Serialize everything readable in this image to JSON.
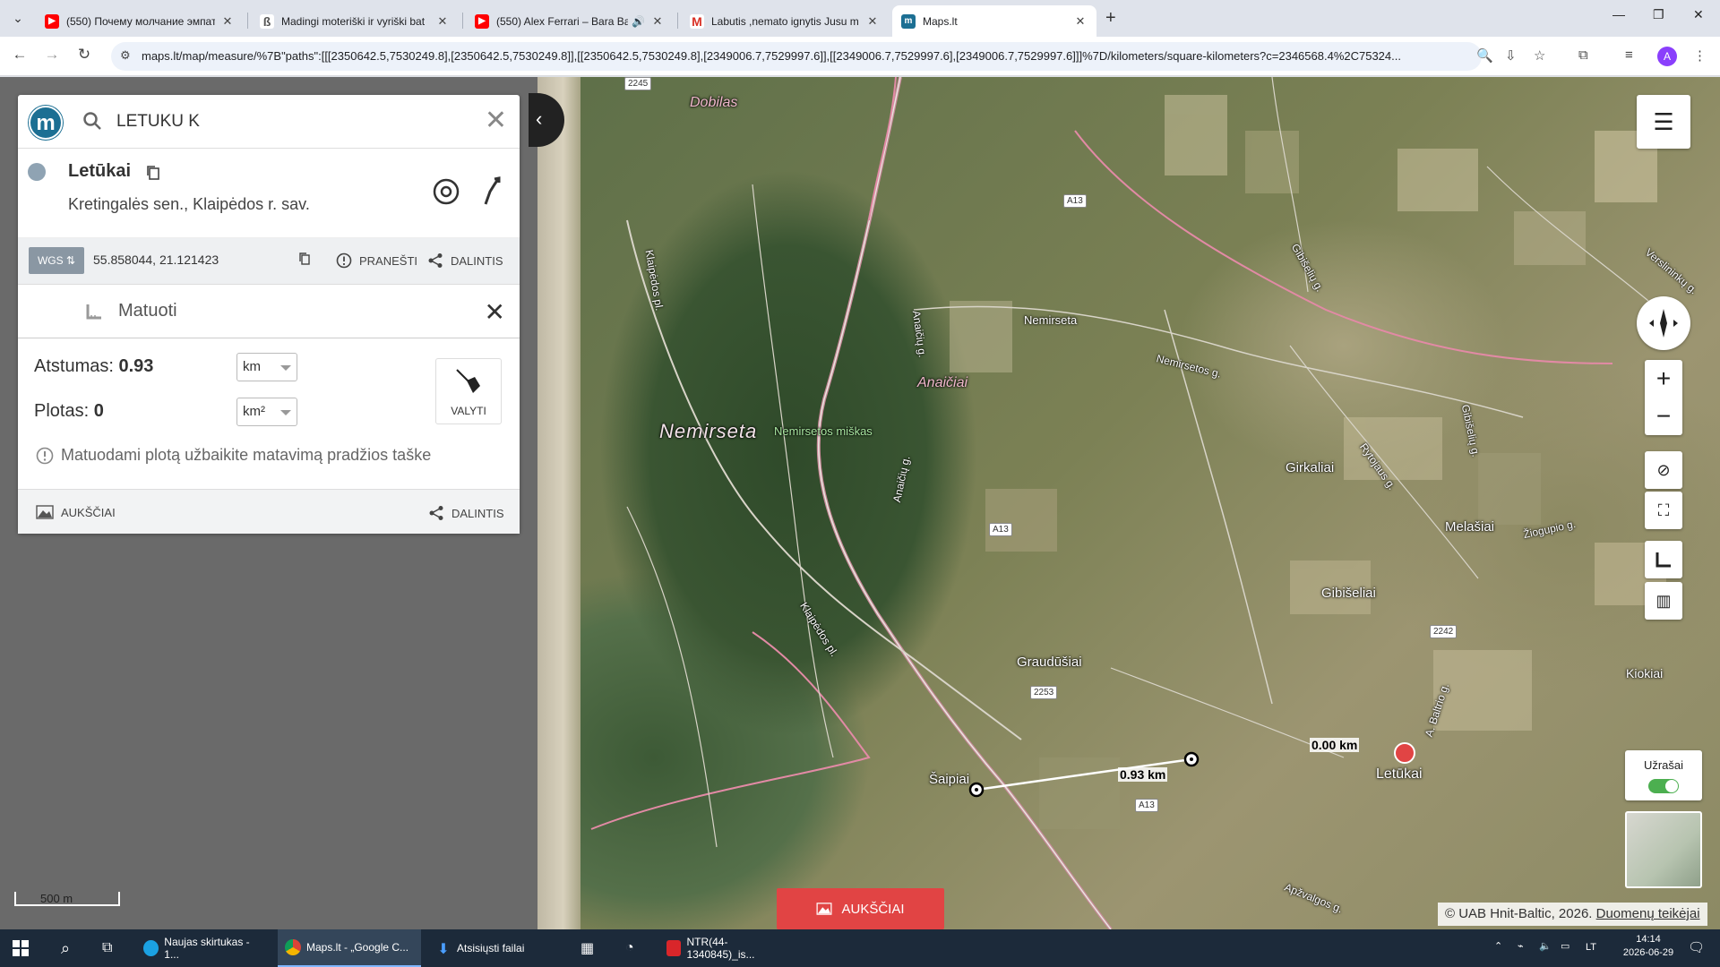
{
  "browser": {
    "tabs": [
      {
        "title": "(550) Почему молчание эмпат",
        "favicon": "youtube-icon",
        "color": "#ff0000"
      },
      {
        "title": "Madingi moteriški ir vyriški bat",
        "favicon": "page-icon",
        "color": "#555555"
      },
      {
        "title": "(550) Alex Ferrari – Bara Ba",
        "favicon": "youtube-icon",
        "color": "#ff0000"
      },
      {
        "title": "Labutis ,nemato ignytis Jusu m",
        "favicon": "gmail-icon",
        "color": "#d93025"
      },
      {
        "title": "Maps.lt",
        "favicon": "mapslt-icon",
        "color": "#1c6f93",
        "active": true
      }
    ],
    "url": "maps.lt/map/measure/%7B\"paths\":[[[2350642.5,7530249.8],[2350642.5,7530249.8]],[[2350642.5,7530249.8],[2349006.7,7529997.6]],[[2349006.7,7529997.6],[2349006.7,7529997.6]]]%7D/kilometers/square-kilometers?c=2346568.4%2C75324...",
    "profile_initial": "A"
  },
  "search": {
    "value": "LETUKU K"
  },
  "place": {
    "name": "Letūkai",
    "subtitle": "Kretingalės sen., Klaipėdos r. sav."
  },
  "coords": {
    "system": "WGS",
    "value": "55.858044, 21.121423",
    "report_label": "PRANEŠTI",
    "share_label": "DALINTIS"
  },
  "measure": {
    "title": "Matuoti",
    "distance_label": "Atstumas:",
    "distance_value": "0.93",
    "distance_unit": "km",
    "area_label": "Plotas:",
    "area_value": "0",
    "area_unit": "km²",
    "clear_label": "VALYTI",
    "hint": "Matuodami plotą užbaikite matavimą pradžios taške"
  },
  "panel_footer": {
    "elevations_label": "AUKŠČIAI",
    "share_label": "DALINTIS"
  },
  "map": {
    "labels": {
      "dobilas": "Dobilas",
      "nemirseta_big": "Nemirseta",
      "nemirsetos_miskas": "Nemirsetos miškas",
      "anaiciai": "Anaičiai",
      "nemirseta": "Nemirseta",
      "girkaliai": "Girkaliai",
      "melasiai": "Melašiai",
      "gibiseliai": "Gibišeliai",
      "graudusiai": "Graudūšiai",
      "saipiai": "Šaipiai",
      "letukai": "Letūkai",
      "kiokiai": "Kiokiai",
      "klaipedos_pl": "Klaipėdos pl.",
      "klaipedos_pl_2": "Klaipėdos pl.",
      "nemirsetos_g": "Nemirsetos g.",
      "anaiciu_g": "Anaičių g.",
      "anaiciu_g2": "Anaičių g.",
      "gibiseliu_g": "Gibišelių g.",
      "gibiseliu_g2": "Gibišelių g.",
      "rytojaus_g": "Rytojaus g.",
      "verslininku_g": "Verslininkų g.",
      "ziogupio_g": "Žiogupio g.",
      "a_baltrio_g": "A. Baltrio g.",
      "apzvalgos_g": "Apžvalgos g."
    },
    "road_badges": {
      "a13_top": "A13",
      "a13_mid": "A13",
      "a13_bottom": "A13",
      "r2253": "2253",
      "r2242": "2242",
      "r2245": "2245"
    },
    "measure_points": {
      "start_label": "0.00 km",
      "end_label": "0.93 km"
    },
    "scale_label": "500 m",
    "notes_label": "Užrašai",
    "elevations_button": "AUKŠČIAI",
    "copyright": "© UAB Hnit-Baltic, 2026.",
    "copyright_link": "Duomenų teikėjai"
  },
  "taskbar": {
    "items": [
      {
        "label": "Naujas skirtukas - 1...",
        "icon": "edge-icon"
      },
      {
        "label": "Maps.lt - „Google C...",
        "icon": "chrome-icon",
        "active": true
      },
      {
        "label": "Atsisiųsti failai",
        "icon": "download-icon"
      },
      {
        "label": "NTR(44-1340845)_is...",
        "icon": "pdf-icon"
      }
    ],
    "lang": "LT",
    "time": "14:14",
    "date": "2026-06-29"
  },
  "colors": {
    "accent": "#1c6f93",
    "measure_line": "#ffffff",
    "pin_red": "#e14444",
    "elevations_button": "#e14444"
  }
}
